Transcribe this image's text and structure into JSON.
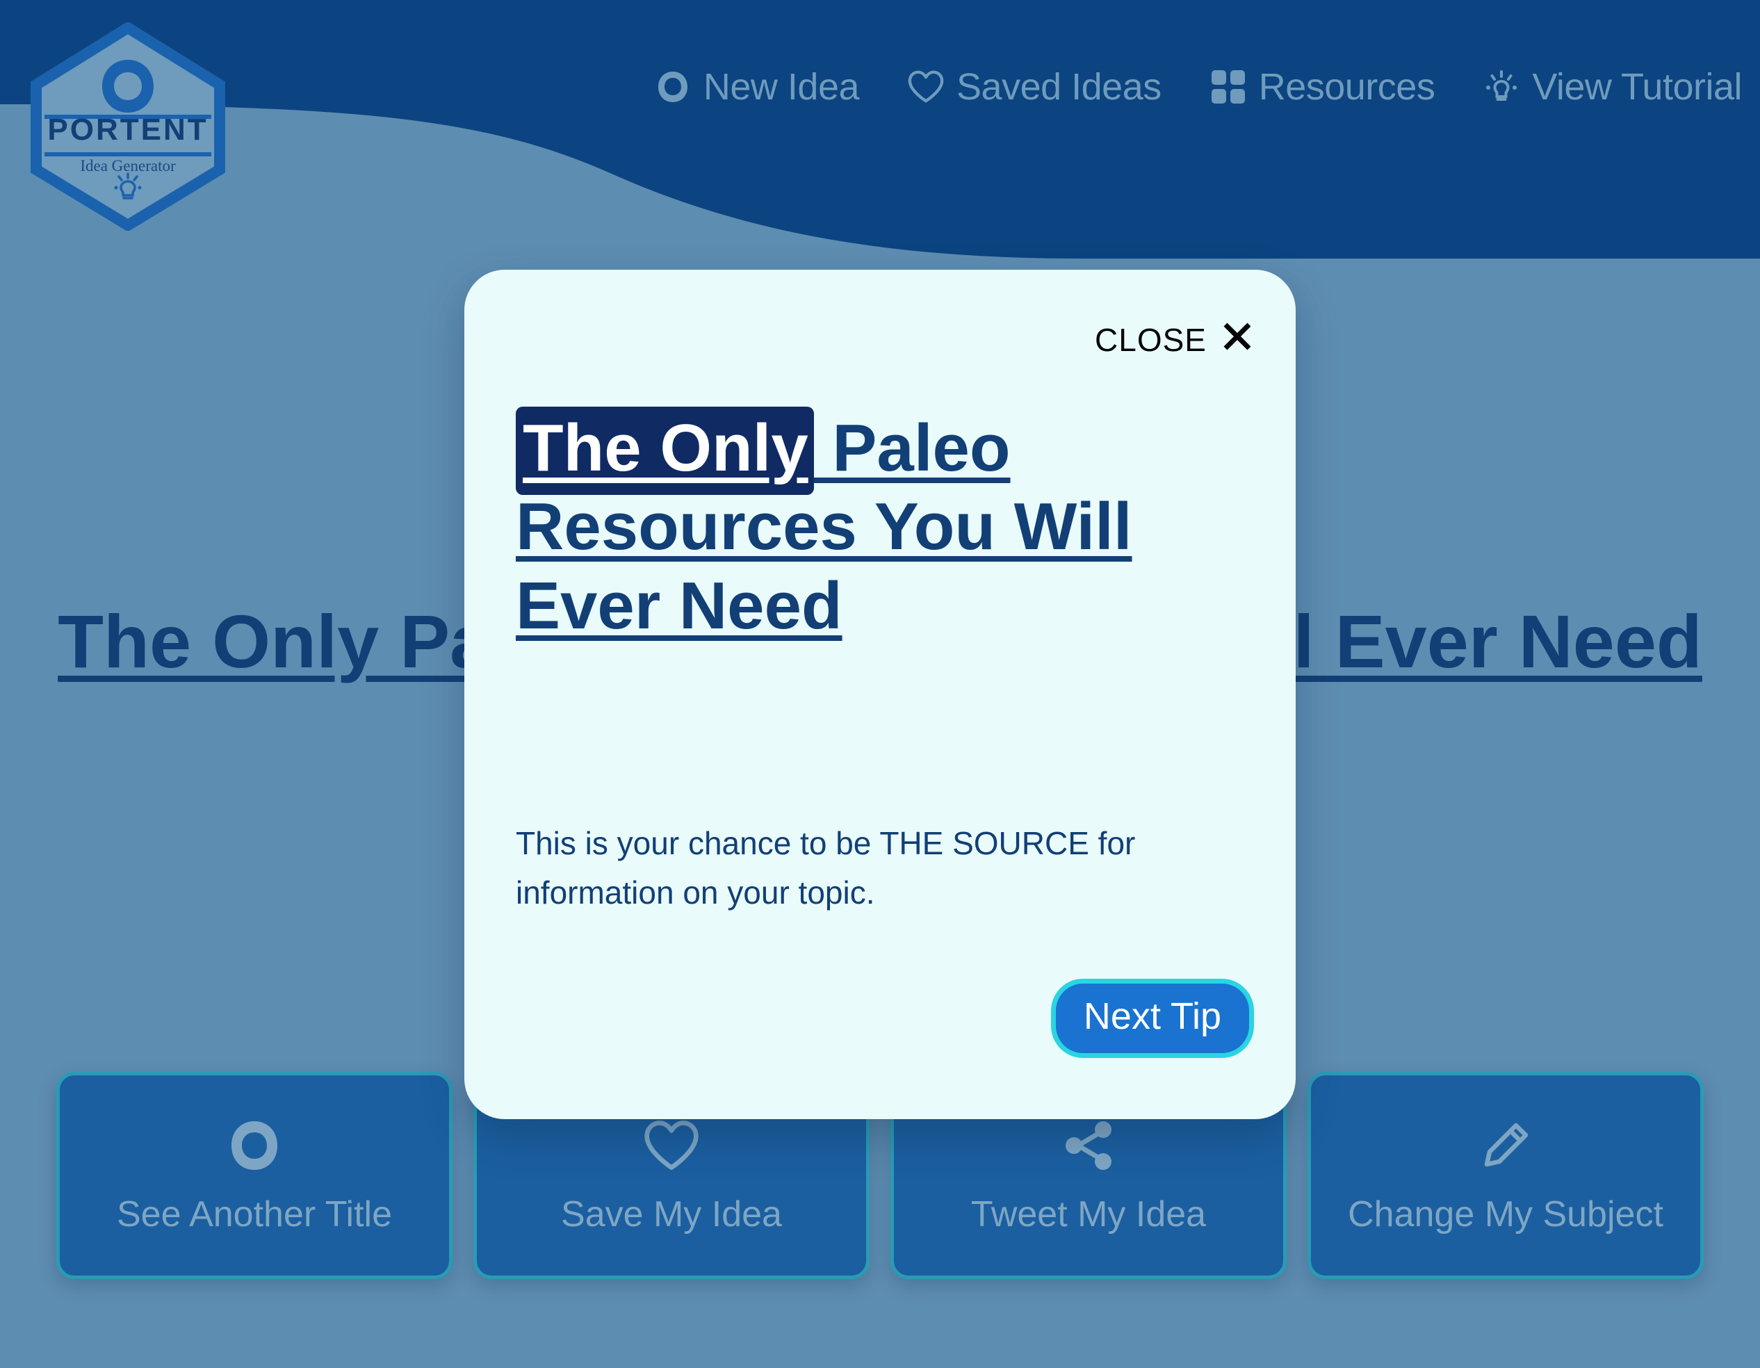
{
  "app": {
    "brand_name": "PORTENT",
    "brand_subtitle": "Idea Generator",
    "logo_icon": "portent-mark-icon",
    "logo_bulb_icon": "lightbulb-icon"
  },
  "colors": {
    "header_dark_blue": "#0b4480",
    "page_blue": "#5e8db2",
    "deep_navy": "#123f75",
    "highlight_navy": "#102b63",
    "modal_bg": "#e9fbfb",
    "accent_cyan": "#2ad4e3",
    "accent_blue": "#1a73d0",
    "button_blue": "#1b5fa0",
    "button_border": "#2a9bb5",
    "muted_label": "#7ea6c4",
    "nav_text": "#6f9bbd"
  },
  "nav": {
    "items": [
      {
        "label": "New Idea",
        "icon": "portent-circle-icon"
      },
      {
        "label": "Saved Ideas",
        "icon": "heart-icon"
      },
      {
        "label": "Resources",
        "icon": "grid-squares-icon"
      },
      {
        "label": "View Tutorial",
        "icon": "lightbulb-icon"
      }
    ]
  },
  "background": {
    "generated_title": "The Only Paleo Resources You Will Ever Need"
  },
  "actions": {
    "buttons": [
      {
        "label": "See Another Title",
        "icon": "refresh-circle-icon"
      },
      {
        "label": "Save My Idea",
        "icon": "heart-icon"
      },
      {
        "label": "Tweet My Idea",
        "icon": "share-icon"
      },
      {
        "label": "Change My Subject",
        "icon": "pencil-icon"
      }
    ]
  },
  "modal": {
    "close_label": "CLOSE",
    "close_icon": "close-x-icon",
    "title_highlight": "The Only",
    "title_rest": " Paleo Resources You Will Ever Need",
    "body": "This is your chance to be THE SOURCE for information on your topic.",
    "next_label": "Next Tip"
  }
}
